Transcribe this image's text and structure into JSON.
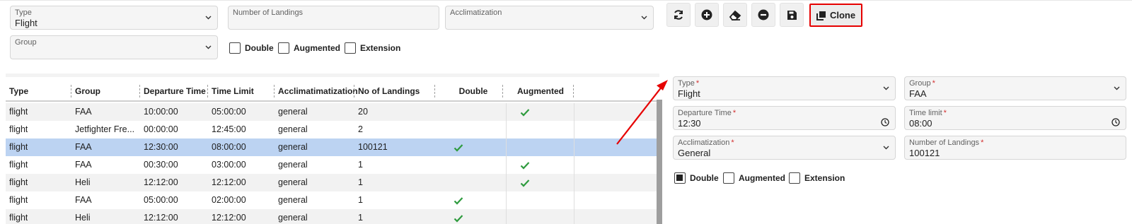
{
  "filters": {
    "type": {
      "label": "Type",
      "value": "Flight"
    },
    "number_of_landings": {
      "label": "Number of Landings",
      "value": ""
    },
    "acclimatization": {
      "label": "Acclimatization",
      "value": ""
    },
    "group": {
      "label": "Group",
      "value": ""
    },
    "double_label": "Double",
    "augmented_label": "Augmented",
    "extension_label": "Extension"
  },
  "toolbar": {
    "buttons": [
      "refresh-icon",
      "add-icon",
      "eraser-icon",
      "remove-icon",
      "save-icon"
    ],
    "clone_label": "Clone"
  },
  "table": {
    "columns": [
      "Type",
      "Group",
      "Departure Time",
      "Time Limit",
      "Acclimatimatization",
      "No of Landings",
      "Double",
      "Augmented"
    ],
    "rows": [
      {
        "type": "flight",
        "group": "FAA",
        "departure": "10:00:00",
        "limit": "05:00:00",
        "acclim": "general",
        "landings": "20",
        "double": false,
        "augmented": true,
        "selected": false
      },
      {
        "type": "flight",
        "group": "Jetfighter Fre...",
        "departure": "00:00:00",
        "limit": "12:45:00",
        "acclim": "general",
        "landings": "2",
        "double": false,
        "augmented": false,
        "selected": false
      },
      {
        "type": "flight",
        "group": "FAA",
        "departure": "12:30:00",
        "limit": "08:00:00",
        "acclim": "general",
        "landings": "100121",
        "double": true,
        "augmented": false,
        "selected": true
      },
      {
        "type": "flight",
        "group": "FAA",
        "departure": "00:30:00",
        "limit": "03:00:00",
        "acclim": "general",
        "landings": "1",
        "double": false,
        "augmented": true,
        "selected": false
      },
      {
        "type": "flight",
        "group": "Heli",
        "departure": "12:12:00",
        "limit": "12:12:00",
        "acclim": "general",
        "landings": "1",
        "double": false,
        "augmented": true,
        "selected": false
      },
      {
        "type": "flight",
        "group": "FAA",
        "departure": "05:00:00",
        "limit": "02:00:00",
        "acclim": "general",
        "landings": "1",
        "double": true,
        "augmented": false,
        "selected": false
      },
      {
        "type": "flight",
        "group": "Heli",
        "departure": "12:12:00",
        "limit": "12:12:00",
        "acclim": "general",
        "landings": "1",
        "double": true,
        "augmented": false,
        "selected": false
      }
    ]
  },
  "detail": {
    "type": {
      "label": "Type",
      "value": "Flight"
    },
    "group": {
      "label": "Group",
      "value": "FAA"
    },
    "departure_time": {
      "label": "Departure Time",
      "value": "12:30"
    },
    "time_limit": {
      "label": "Time limit",
      "value": "08:00"
    },
    "acclimatization": {
      "label": "Acclimatization",
      "value": "General"
    },
    "number_of_landings": {
      "label": "Number of Landings",
      "value": "100121"
    },
    "required_mark": "*",
    "double_label": "Double",
    "double_checked": true,
    "augmented_label": "Augmented",
    "augmented_checked": false,
    "extension_label": "Extension",
    "extension_checked": false
  },
  "colors": {
    "accent_check": "#2e9b3e",
    "selection": "#bcd3f2",
    "highlight_border": "#e60000",
    "annotation_arrow": "#e60000"
  }
}
